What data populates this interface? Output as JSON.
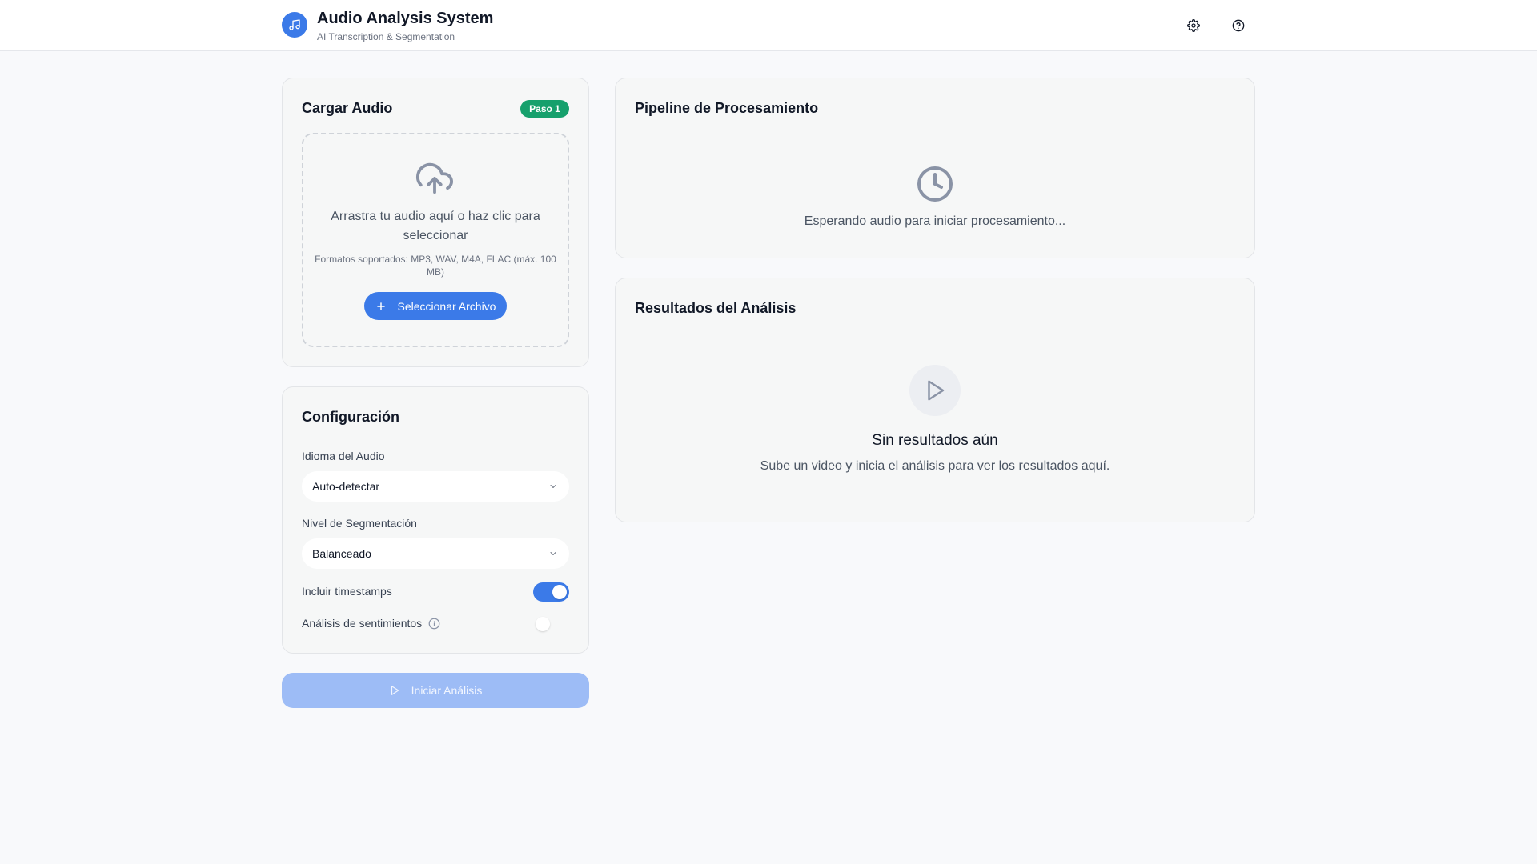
{
  "app": {
    "title": "Audio Analysis System",
    "subtitle": "AI Transcription & Segmentation",
    "logo_icon": "music-note-icon",
    "accent_color": "#3b7ae8"
  },
  "header_actions": {
    "settings_icon": "gear-icon",
    "help_icon": "help-circle-icon"
  },
  "upload": {
    "title": "Cargar Audio",
    "badge": "Paso 1",
    "badge_color": "#16a06c",
    "dropzone_text": "Arrastra tu audio aquí o haz clic para seleccionar",
    "formats_text": "Formatos soportados: MP3, WAV, M4A, FLAC (máx. 100 MB)",
    "select_button": "Seleccionar Archivo",
    "icon": "cloud-upload-icon"
  },
  "config": {
    "title": "Configuración",
    "language_label": "Idioma del Audio",
    "language_value": "Auto-detectar",
    "segmentation_label": "Nivel de Segmentación",
    "segmentation_value": "Balanceado",
    "timestamps_label": "Incluir timestamps",
    "timestamps_on": true,
    "sentiment_label": "Análisis de sentimientos",
    "sentiment_on": false
  },
  "start_button": "Iniciar Análisis",
  "pipeline": {
    "title": "Pipeline de Procesamiento",
    "waiting_text": "Esperando audio para iniciar procesamiento...",
    "icon": "clock-icon"
  },
  "results": {
    "title": "Resultados del Análisis",
    "empty_title": "Sin resultados aún",
    "empty_text": "Sube un video y inicia el análisis para ver los resultados aquí.",
    "icon": "play-icon"
  }
}
